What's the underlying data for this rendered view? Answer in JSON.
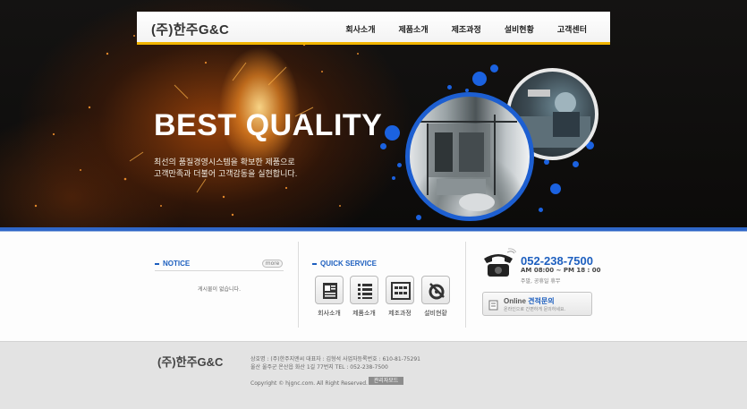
{
  "header": {
    "logo": "(주)한주G&C",
    "menu": [
      "회사소개",
      "제품소개",
      "제조과정",
      "설비현황",
      "고객센터"
    ]
  },
  "hero": {
    "headline": "BEST QUALITY",
    "line1": "최선의 품질경영시스템을 확보한 제품으로",
    "line2": "고객만족과 더불어 고객감동을 실현합니다."
  },
  "notice": {
    "title": "NOTICE",
    "more": "more",
    "empty": "게시물이 없습니다."
  },
  "quick": {
    "title": "QUICK SERVICE",
    "items": [
      "회사소개",
      "제품소개",
      "제조과정",
      "설비현황"
    ]
  },
  "contact": {
    "phone": "052-238-7500",
    "hours": "AM 08:00 ~ PM 18 : 00",
    "holiday": "주말, 공휴일 휴무",
    "online_prefix": "Online",
    "online_highlight": "견적문의",
    "online_sub": "온라인으로 간편하게 문의하세요."
  },
  "footer": {
    "logo": "(주)한주G&C",
    "info1": "상호명 : (주)한주지엔씨 대표자 : 김형석 사업자등록번호 : 610-81-75291",
    "info2": "울산 울주군 온산읍 화산 1길 77번지 TEL : 052-238-7500",
    "copyright": "Copyright © hjgnc.com. All Right Reserved.",
    "admin": "관리자모드"
  },
  "colors": {
    "accent": "#1d5fbf",
    "nav_underline": "#f1b400",
    "divider_blue": "#2f67c8"
  }
}
